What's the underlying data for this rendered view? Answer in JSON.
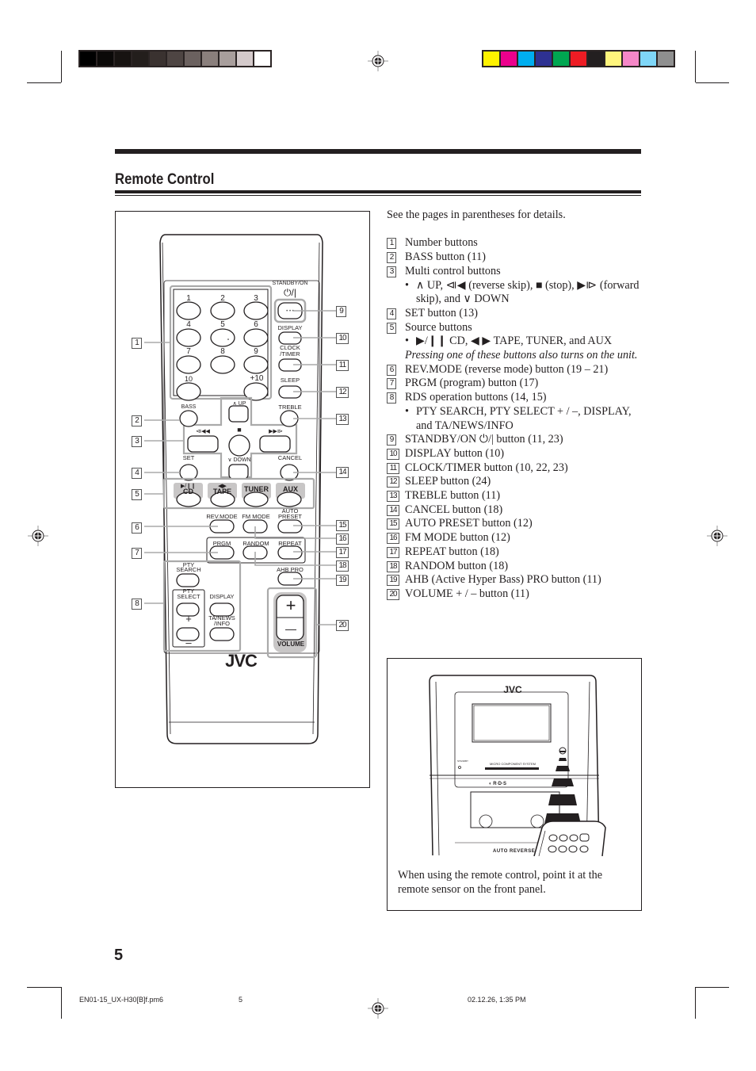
{
  "page": {
    "section_title": "Remote Control",
    "page_number": "5"
  },
  "color_bars": {
    "gray_swatches": [
      "#000000",
      "#0b0908",
      "#171311",
      "#231e1c",
      "#3a3230",
      "#4e4543",
      "#6b615f",
      "#8a7f7c",
      "#a89e9c",
      "#d4cacb",
      "#ffffff"
    ],
    "color_swatches": [
      "#fff200",
      "#ec008c",
      "#00aeef",
      "#2e3192",
      "#00a651",
      "#ed1c24",
      "#231f20",
      "#fff57d",
      "#f587c7",
      "#7fd6f7",
      "#8f8f8f"
    ]
  },
  "intro": "See the pages in parentheses for details.",
  "items": [
    {
      "n": "1",
      "text": "Number buttons"
    },
    {
      "n": "2",
      "text": "BASS button (11)"
    },
    {
      "n": "3",
      "text": "Multi control buttons",
      "bullets": [
        "∧ UP, ⧏◀ (reverse skip), ■ (stop), ▶⧐ (forward skip), and ∨ DOWN"
      ]
    },
    {
      "n": "4",
      "text": "SET button (13)"
    },
    {
      "n": "5",
      "text": "Source buttons",
      "bullets": [
        "▶/❙❙ CD, ◀ ▶ TAPE, TUNER, and AUX"
      ],
      "note": "Pressing one of these buttons also turns on the unit."
    },
    {
      "n": "6",
      "text": "REV.MODE (reverse mode) button (19 – 21)"
    },
    {
      "n": "7",
      "text": "PRGM (program) button (17)"
    },
    {
      "n": "8",
      "text": "RDS operation buttons (14, 15)",
      "bullets": [
        "PTY SEARCH, PTY SELECT + / –, DISPLAY, and TA/NEWS/INFO"
      ]
    },
    {
      "n": "9",
      "text": "STANDBY/ON ⏻/| button (11, 23)"
    },
    {
      "n": "10",
      "text": "DISPLAY button (10)"
    },
    {
      "n": "11",
      "text": "CLOCK/TIMER button (10, 22, 23)"
    },
    {
      "n": "12",
      "text": "SLEEP button (24)"
    },
    {
      "n": "13",
      "text": "TREBLE button (11)"
    },
    {
      "n": "14",
      "text": "CANCEL button (18)"
    },
    {
      "n": "15",
      "text": "AUTO PRESET button (12)"
    },
    {
      "n": "16",
      "text": "FM MODE button (12)"
    },
    {
      "n": "17",
      "text": "REPEAT button (18)"
    },
    {
      "n": "18",
      "text": "RANDOM button (18)"
    },
    {
      "n": "19",
      "text": "AHB (Active Hyper Bass) PRO button (11)"
    },
    {
      "n": "20",
      "text": "VOLUME + / – button (11)"
    }
  ],
  "remote": {
    "standby_label": "STANDBY/ON",
    "standby_symbol": "⏻/|",
    "numbers": [
      "1",
      "2",
      "3",
      "4",
      "5",
      "6",
      "7",
      "8",
      "9",
      "10",
      "+10"
    ],
    "display": "DISPLAY",
    "clock_timer": "CLOCK\n/TIMER",
    "clock": "CLOCK",
    "timer": "/TIMER",
    "sleep": "SLEEP",
    "bass": "BASS",
    "treble": "TREBLE",
    "up": "∧ UP",
    "down": "∨ DOWN",
    "rev_skip": "⧏◀◀",
    "stop": "■",
    "fwd_skip": "▶▶⧐",
    "set": "SET",
    "cancel": "CANCEL",
    "cd_symbol": "▶/❙❙",
    "cd": "CD",
    "tape_symbol": "◀▶",
    "tape": "TAPE",
    "tuner": "TUNER",
    "aux": "AUX",
    "rev_mode": "REV.MODE",
    "fm_mode": "FM MODE",
    "auto": "AUTO",
    "preset": "PRESET",
    "prgm": "PRGM",
    "random": "RANDOM",
    "repeat": "REPEAT",
    "pty": "PTY",
    "search": "SEARCH",
    "select": "SELECT",
    "display2": "DISPLAY",
    "plus": "+",
    "minus": "–",
    "ta_news": "TA/NEWS",
    "info": "/INFO",
    "ahb_pro": "AHB PRO",
    "vol_plus": "+",
    "vol_minus": "—",
    "volume": "VOLUME",
    "brand": "JVC"
  },
  "unit_illustration": {
    "brand": "JVC",
    "standby": "STANDBY",
    "system_label": "MICRO COMPONENT SYSTEM",
    "auto_reverse": "AUTO REVERSE",
    "caption": "When using the remote control, point it at the remote sensor on the front panel."
  },
  "footer": {
    "filename": "EN01-15_UX-H30[B]f.pm6",
    "page": "5",
    "timestamp": "02.12.26, 1:35 PM"
  }
}
